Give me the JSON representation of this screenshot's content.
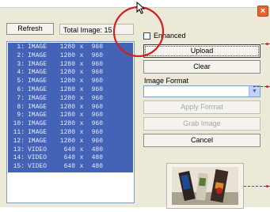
{
  "toolbar": {
    "refresh_label": "Refresh",
    "total_label": "Total Image: 15"
  },
  "list": {
    "items": [
      {
        "index": "1:",
        "type": "IMAGE",
        "w": "1280",
        "x": "x",
        "h": "960"
      },
      {
        "index": "2:",
        "type": "IMAGE",
        "w": "1280",
        "x": "x",
        "h": "960"
      },
      {
        "index": "3:",
        "type": "IMAGE",
        "w": "1280",
        "x": "x",
        "h": "960"
      },
      {
        "index": "4:",
        "type": "IMAGE",
        "w": "1280",
        "x": "x",
        "h": "960"
      },
      {
        "index": "5:",
        "type": "IMAGE",
        "w": "1280",
        "x": "x",
        "h": "960"
      },
      {
        "index": "6:",
        "type": "IMAGE",
        "w": "1280",
        "x": "x",
        "h": "960"
      },
      {
        "index": "7:",
        "type": "IMAGE",
        "w": "1280",
        "x": "x",
        "h": "960"
      },
      {
        "index": "8:",
        "type": "IMAGE",
        "w": "1280",
        "x": "x",
        "h": "960"
      },
      {
        "index": "9:",
        "type": "IMAGE",
        "w": "1280",
        "x": "x",
        "h": "960"
      },
      {
        "index": "10:",
        "type": "IMAGE",
        "w": "1280",
        "x": "x",
        "h": "960"
      },
      {
        "index": "11:",
        "type": "IMAGE",
        "w": "1280",
        "x": "x",
        "h": "960"
      },
      {
        "index": "12:",
        "type": "IMAGE",
        "w": "1280",
        "x": "x",
        "h": "960"
      },
      {
        "index": "13:",
        "type": "VIDEO",
        "w": "640",
        "x": "x",
        "h": "480"
      },
      {
        "index": "14:",
        "type": "VIDEO",
        "w": "640",
        "x": "x",
        "h": "480"
      },
      {
        "index": "15:",
        "type": "VIDEO",
        "w": "640",
        "x": "x",
        "h": "480"
      }
    ]
  },
  "options": {
    "enhanced_label": "Enhanced",
    "enhanced_checked": false
  },
  "actions": {
    "upload_label": "Upload",
    "clear_label": "Clear",
    "image_format_label": "Image Format",
    "image_format_value": "",
    "apply_format_label": "Apply Format",
    "grab_image_label": "Grab Image",
    "cancel_label": "Cancel"
  },
  "window": {
    "close_glyph": "×"
  },
  "icons": {
    "close": "close-icon",
    "cursor": "mouse-cursor-icon",
    "dropdown": "chevron-down-icon"
  },
  "colors": {
    "selection": "#4463b6",
    "annotation": "#d21f1f",
    "close_button": "#e8632a"
  }
}
